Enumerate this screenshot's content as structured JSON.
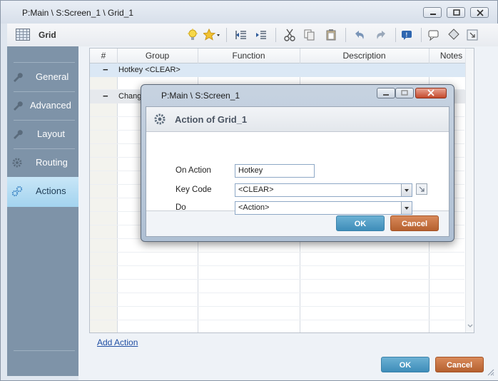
{
  "window": {
    "title": "P:Main \\ S:Screen_1 \\ Grid_1"
  },
  "toolbar": {
    "title": "Grid",
    "icons": [
      "bulb-icon",
      "star-icon",
      "outdent-icon",
      "indent-icon",
      "cut-icon",
      "copy-icon",
      "paste-icon",
      "undo-icon",
      "redo-icon",
      "info-icon",
      "comment-icon",
      "tag-icon",
      "export-icon"
    ]
  },
  "sidebar": {
    "items": [
      {
        "label": "General",
        "icon": "wrench-icon"
      },
      {
        "label": "Advanced",
        "icon": "wrench-icon"
      },
      {
        "label": "Layout",
        "icon": "wrench-icon"
      },
      {
        "label": "Routing",
        "icon": "gear-icon"
      },
      {
        "label": "Actions",
        "icon": "gears-icon"
      }
    ]
  },
  "table": {
    "headers": [
      "#",
      "Group",
      "Function",
      "Description",
      "Notes"
    ],
    "rows": [
      {
        "toggle": "−",
        "text": "Hotkey <CLEAR>"
      },
      {
        "toggle": "−",
        "text": "Change"
      }
    ]
  },
  "add_action": "Add Action",
  "footer": {
    "ok": "OK",
    "cancel": "Cancel"
  },
  "dialog": {
    "title": "P:Main \\ S:Screen_1",
    "header": "Action of Grid_1",
    "fields": {
      "on_action_label": "On Action",
      "on_action_value": "Hotkey",
      "key_code_label": "Key Code",
      "key_code_value": "<CLEAR>",
      "do_label": "Do",
      "do_value": "<Action>"
    },
    "ok": "OK",
    "cancel": "Cancel"
  },
  "colors": {
    "sidebar": "#7e93a8",
    "sidebar_active": "#b5dcf2",
    "ok_button": "#4a97c2",
    "cancel_button": "#c46a38"
  }
}
